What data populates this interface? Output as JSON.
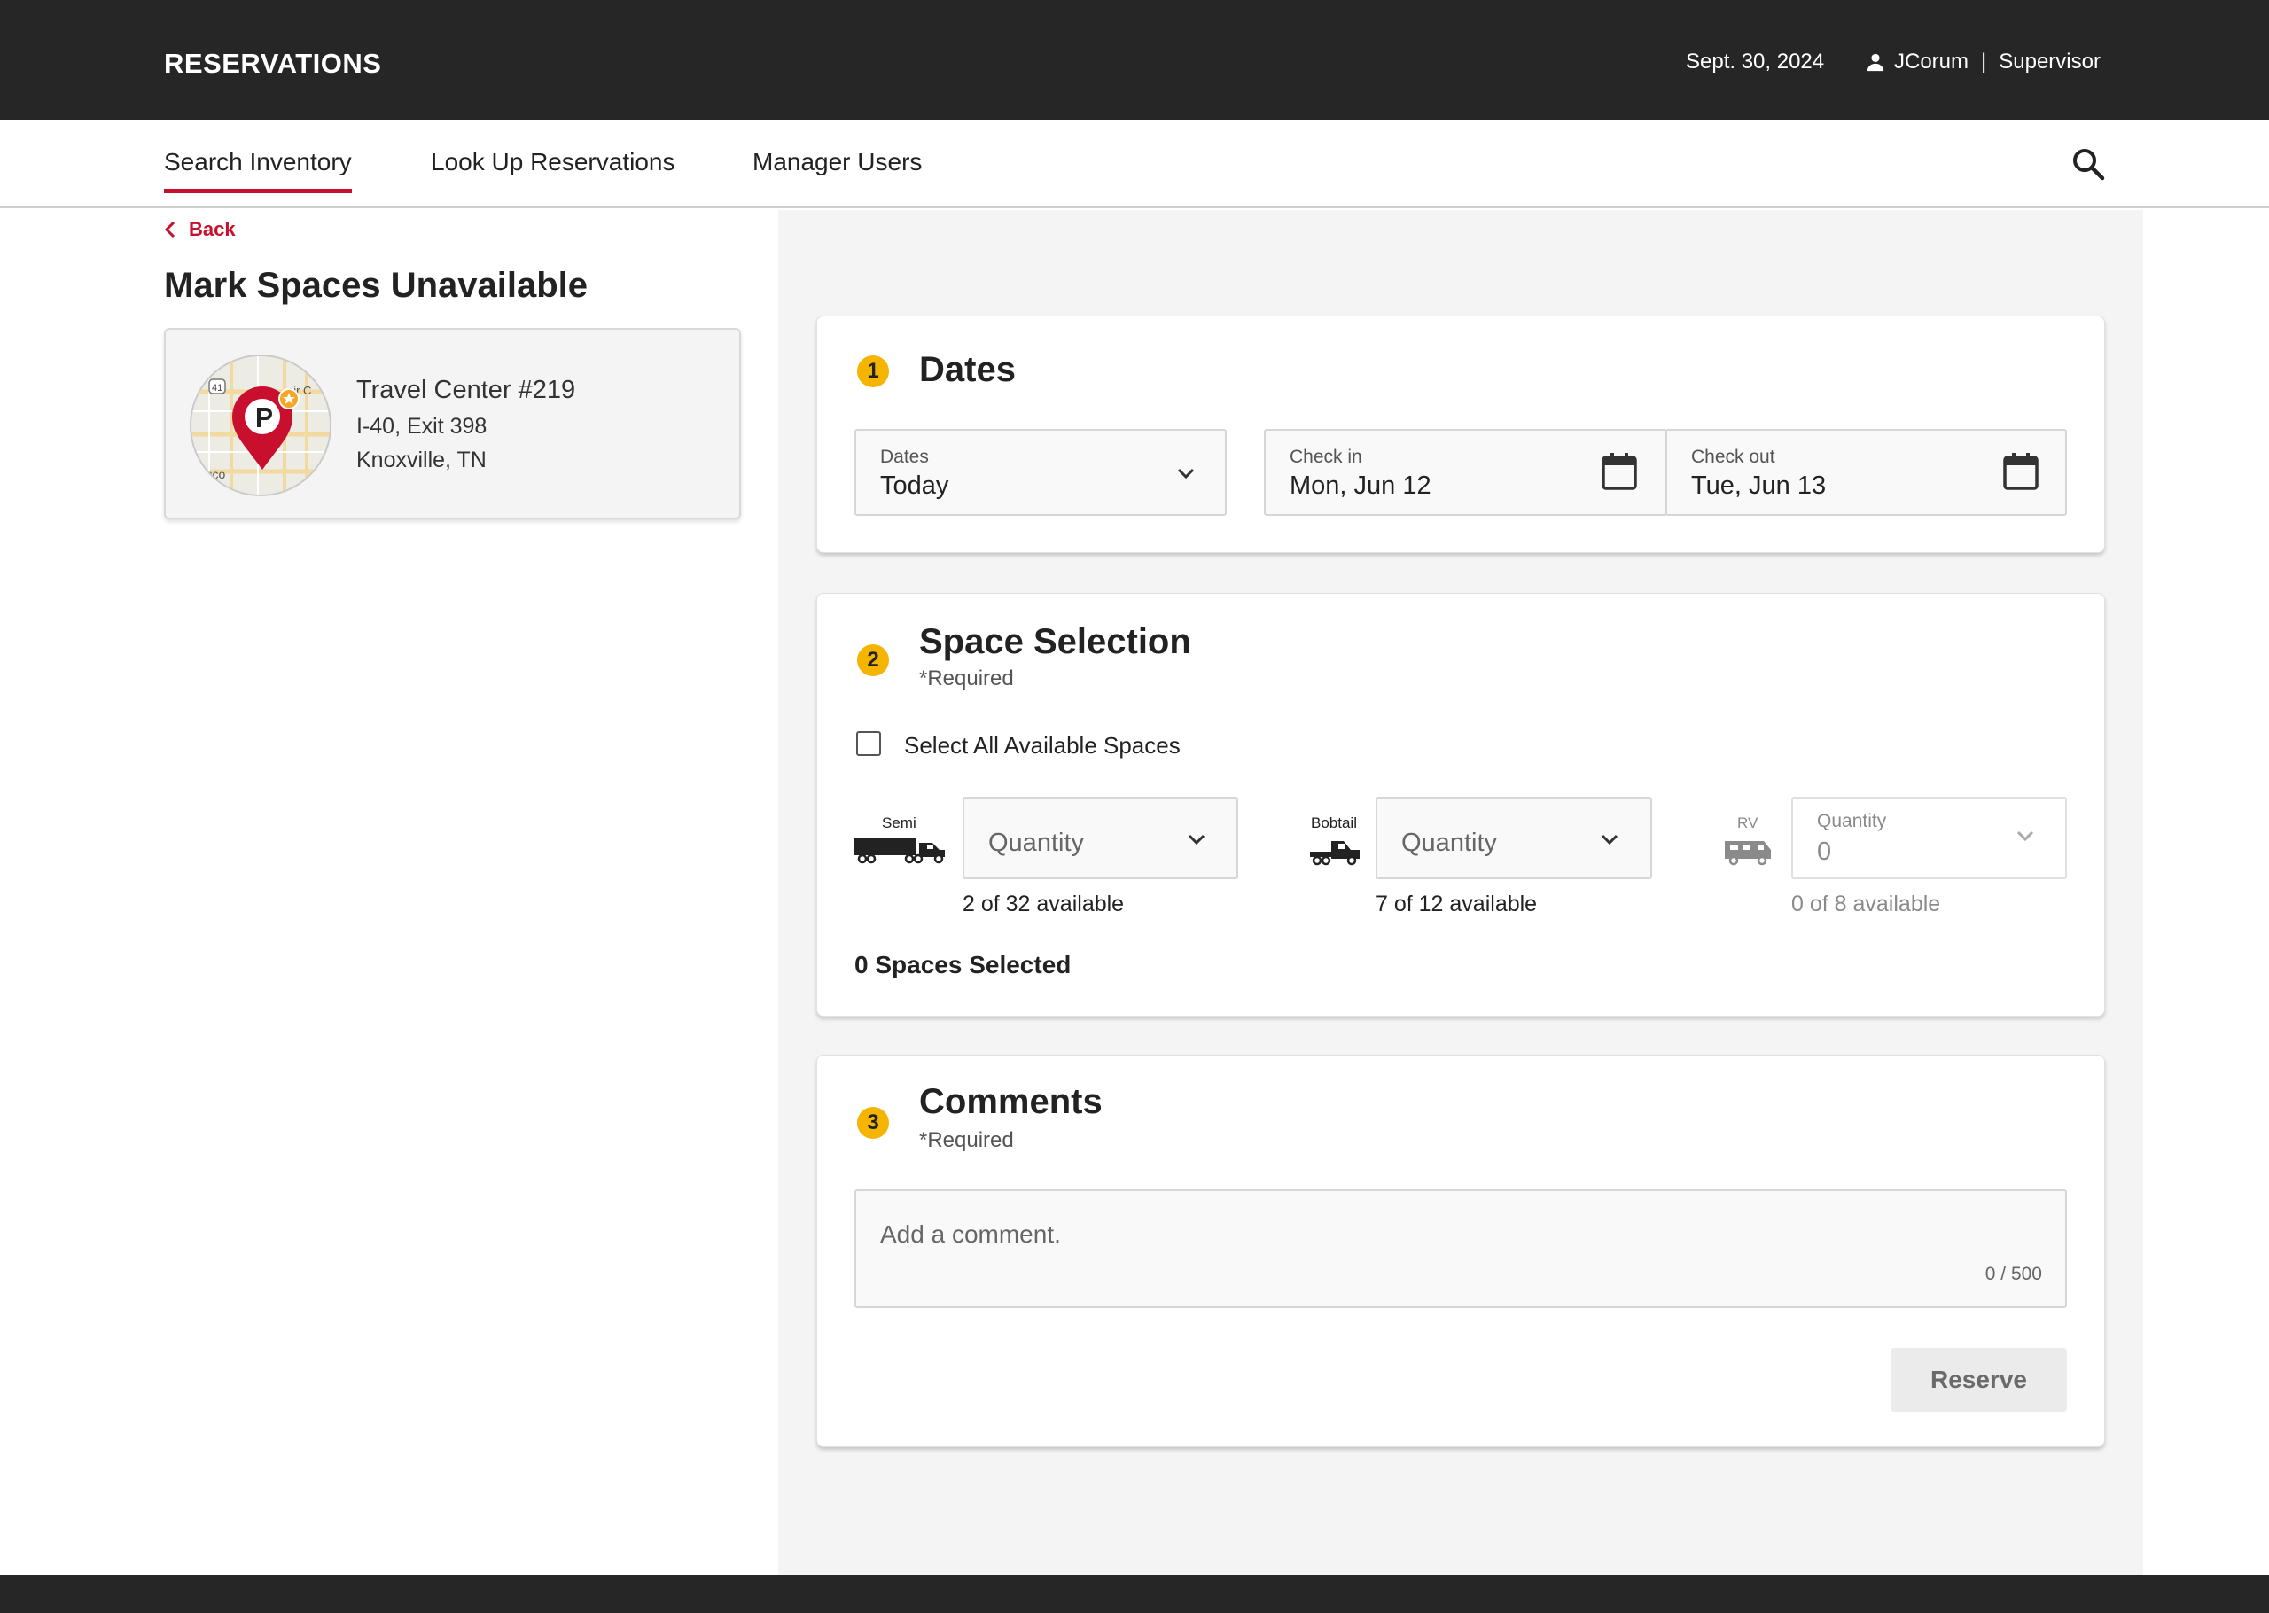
{
  "app": {
    "brand": "RESERVATIONS",
    "date": "Sept. 30, 2024",
    "user": "JCorum",
    "separator": "|",
    "role": "Supervisor"
  },
  "nav": {
    "tabs": [
      "Search Inventory",
      "Look Up Reservations",
      "Manager Users"
    ],
    "active": "Search Inventory"
  },
  "page": {
    "back_label": "Back",
    "title": "Mark Spaces Unavailable"
  },
  "location": {
    "name": "Travel Center #219",
    "line1": "I-40, Exit 398",
    "line2": "Knoxville, TN",
    "map_labels": [
      "41",
      "air C",
      "rocco"
    ]
  },
  "dates_section": {
    "step": "1",
    "title": "Dates",
    "dates_field": {
      "label": "Dates",
      "value": "Today"
    },
    "checkin": {
      "label": "Check in",
      "value": "Mon, Jun 12"
    },
    "checkout": {
      "label": "Check out",
      "value": "Tue, Jun 13"
    }
  },
  "space_section": {
    "step": "2",
    "title": "Space Selection",
    "required": "*Required",
    "select_all_label": "Select All Available Spaces",
    "vehicles": [
      {
        "name": "Semi",
        "placeholder": "Quantity",
        "availability": "2 of 32 available"
      },
      {
        "name": "Bobtail",
        "placeholder": "Quantity",
        "availability": "7 of 12 available"
      },
      {
        "name": "RV",
        "label": "Quantity",
        "value": "0",
        "availability": "0 of 8 available"
      }
    ],
    "selected_summary": "0 Spaces Selected"
  },
  "comments_section": {
    "step": "3",
    "title": "Comments",
    "required": "*Required",
    "placeholder": "Add a comment.",
    "counter": "0 / 500",
    "reserve_label": "Reserve"
  },
  "colors": {
    "accent": "#c8102e",
    "badge": "#f5b400",
    "topbar": "#262626",
    "panel": "#f4f4f4"
  },
  "icons": [
    "user-icon",
    "search-icon",
    "chevron-left-icon",
    "map-pin-icon",
    "chevron-down-icon",
    "calendar-icon",
    "semi-truck-icon",
    "bobtail-truck-icon",
    "rv-icon"
  ]
}
